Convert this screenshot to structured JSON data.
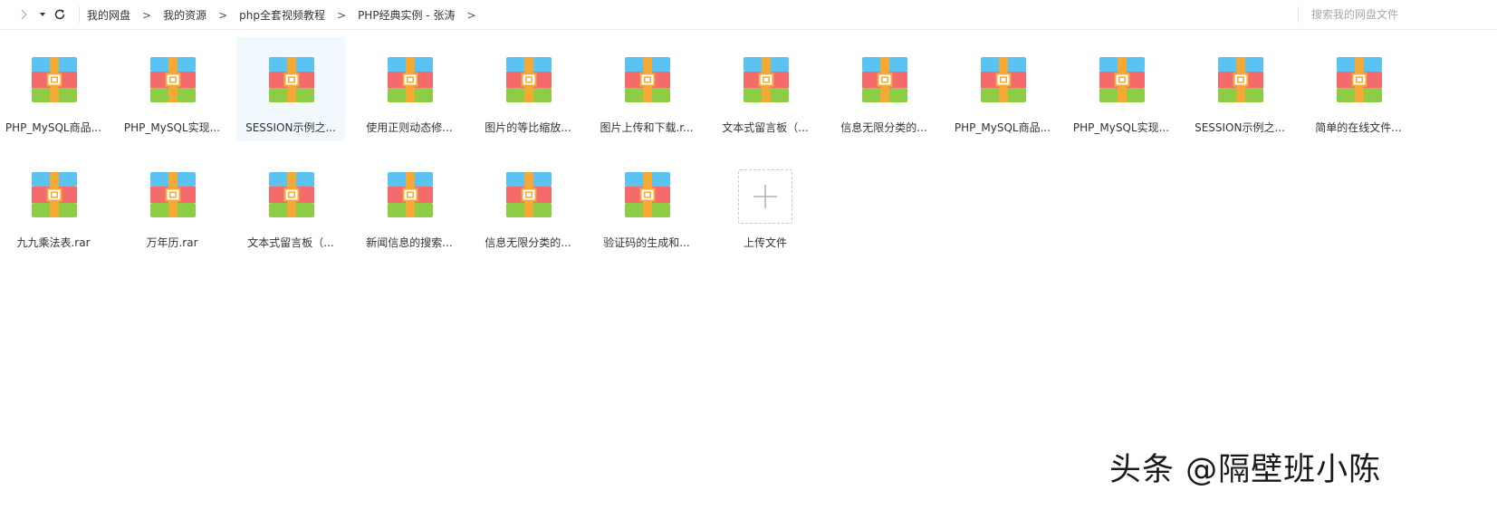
{
  "toolbar": {
    "forward_icon": "chevron-right-icon",
    "dropdown_icon": "caret-down-icon",
    "refresh_icon": "refresh-icon"
  },
  "breadcrumb": {
    "items": [
      "我的网盘",
      "我的资源",
      "php全套视频教程",
      "PHP经典实例 - 张涛"
    ],
    "separator": ">"
  },
  "search": {
    "placeholder": "搜索我的网盘文件"
  },
  "files": [
    {
      "name": "PHP_MySQL商品...",
      "icon": "rar-archive-icon",
      "selected": false
    },
    {
      "name": "PHP_MySQL实现...",
      "icon": "rar-archive-icon",
      "selected": false
    },
    {
      "name": "SESSION示例之...",
      "icon": "rar-archive-icon",
      "selected": true
    },
    {
      "name": "使用正则动态修...",
      "icon": "rar-archive-icon",
      "selected": false
    },
    {
      "name": "图片的等比缩放...",
      "icon": "rar-archive-icon",
      "selected": false
    },
    {
      "name": "图片上传和下载.r...",
      "icon": "rar-archive-icon",
      "selected": false
    },
    {
      "name": "文本式留言板（...",
      "icon": "rar-archive-icon",
      "selected": false
    },
    {
      "name": "信息无限分类的...",
      "icon": "rar-archive-icon",
      "selected": false
    },
    {
      "name": "PHP_MySQL商品...",
      "icon": "rar-archive-icon",
      "selected": false
    },
    {
      "name": "PHP_MySQL实现...",
      "icon": "rar-archive-icon",
      "selected": false
    },
    {
      "name": "SESSION示例之...",
      "icon": "rar-archive-icon",
      "selected": false
    },
    {
      "name": "简单的在线文件...",
      "icon": "rar-archive-icon",
      "selected": false
    },
    {
      "name": "九九乘法表.rar",
      "icon": "rar-archive-icon",
      "selected": false
    },
    {
      "name": "万年历.rar",
      "icon": "rar-archive-icon",
      "selected": false
    },
    {
      "name": "文本式留言板（...",
      "icon": "rar-archive-icon",
      "selected": false
    },
    {
      "name": "新闻信息的搜索...",
      "icon": "rar-archive-icon",
      "selected": false
    },
    {
      "name": "信息无限分类的...",
      "icon": "rar-archive-icon",
      "selected": false
    },
    {
      "name": "验证码的生成和...",
      "icon": "rar-archive-icon",
      "selected": false
    }
  ],
  "upload": {
    "label": "上传文件",
    "icon": "plus-icon"
  },
  "watermark": {
    "text": "头条 @隔壁班小陈"
  },
  "colors": {
    "archive_top": "#5bc3f2",
    "archive_middle": "#f56a6a",
    "archive_bottom": "#8dcc45",
    "archive_strap": "#f5a935",
    "selected_bg": "#f1f8fe"
  }
}
